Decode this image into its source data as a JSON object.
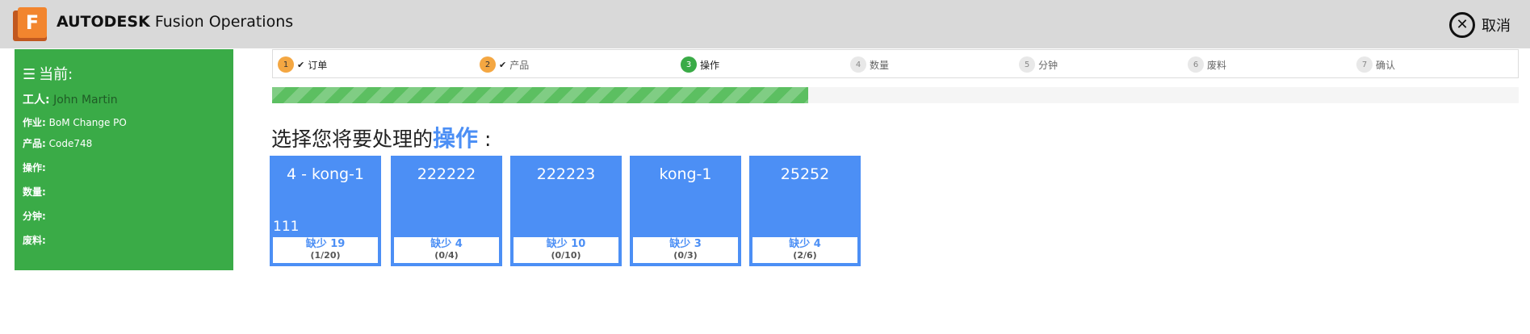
{
  "header": {
    "app_brand_bold": "AUTODESK",
    "app_brand_rest": "Fusion Operations",
    "logo_letter": "F",
    "cancel_label": "取消"
  },
  "sidebar": {
    "title": "当前:",
    "worker_label": "工人:",
    "worker_value": "John Martin",
    "job_label": "作业:",
    "job_value": "BoM Change PO",
    "product_label": "产品:",
    "product_value": "Code748",
    "operation_label": "操作:",
    "quantity_label": "数量:",
    "minutes_label": "分钟:",
    "scrap_label": "废料:"
  },
  "steps": [
    {
      "num": "1",
      "label": "订单",
      "state": "done"
    },
    {
      "num": "2",
      "label": "产品",
      "state": "done"
    },
    {
      "num": "3",
      "label": "操作",
      "state": "active"
    },
    {
      "num": "4",
      "label": "数量",
      "state": "todo"
    },
    {
      "num": "5",
      "label": "分钟",
      "state": "todo"
    },
    {
      "num": "6",
      "label": "废料",
      "state": "todo"
    },
    {
      "num": "7",
      "label": "确认",
      "state": "todo"
    }
  ],
  "progress": {
    "fraction": 0.43
  },
  "prompt": {
    "before": "选择您将要处理的",
    "emphasis": "操作",
    "after": " :"
  },
  "operations": [
    {
      "title": "4 - kong-1",
      "description": "111",
      "missing": "缺少 19",
      "count": "(1/20)"
    },
    {
      "title": "222222",
      "description": "",
      "missing": "缺少 4",
      "count": "(0/4)"
    },
    {
      "title": "222223",
      "description": "",
      "missing": "缺少 10",
      "count": "(0/10)"
    },
    {
      "title": "kong-1",
      "description": "",
      "missing": "缺少 3",
      "count": "(0/3)"
    },
    {
      "title": "25252",
      "description": "",
      "missing": "缺少 4",
      "count": "(2/6)"
    }
  ],
  "colors": {
    "accent_blue": "#4c8ff5",
    "sidebar_green": "#3aab47",
    "step_done": "#f4a742"
  }
}
